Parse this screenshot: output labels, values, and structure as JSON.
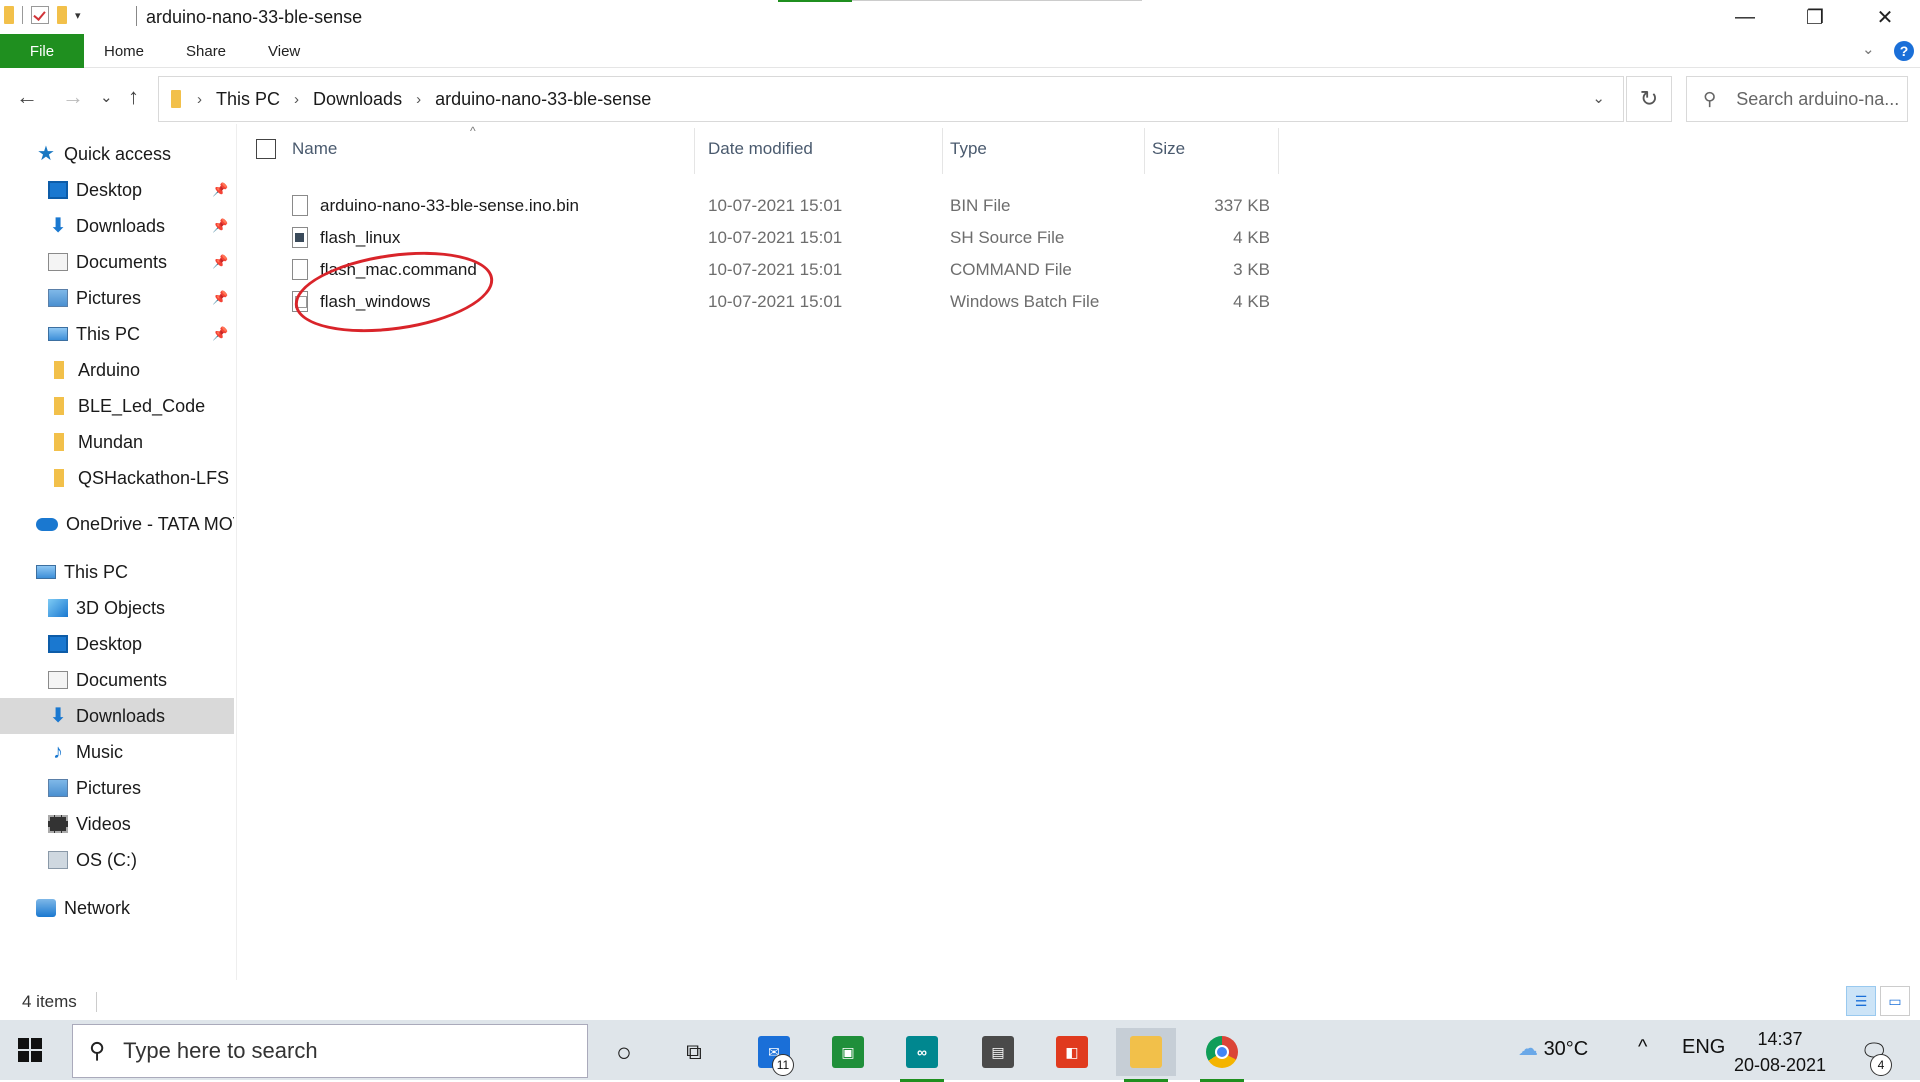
{
  "window": {
    "title": "arduino-nano-33-ble-sense",
    "controls": {
      "minimize": "—",
      "maximize": "❐",
      "close": "✕"
    }
  },
  "ribbon": {
    "tabs": [
      "File",
      "Home",
      "Share",
      "View"
    ],
    "help": "?",
    "expand": "⌄"
  },
  "address": {
    "nav": {
      "back": "←",
      "forward": "→",
      "recent": "⌄",
      "up": "↑"
    },
    "crumbs": [
      "This PC",
      "Downloads",
      "arduino-nano-33-ble-sense"
    ],
    "separator": "›",
    "dropdown": "⌄",
    "refresh": "↻",
    "search_placeholder": "Search arduino-na..."
  },
  "nav_pane": {
    "pin_glyph": "📌",
    "items": [
      {
        "label": "Quick access",
        "icon": "star-icon"
      },
      {
        "label": "Desktop",
        "icon": "desktop-icon",
        "pinned": true
      },
      {
        "label": "Downloads",
        "icon": "download-icon",
        "pinned": true
      },
      {
        "label": "Documents",
        "icon": "documents-icon",
        "pinned": true
      },
      {
        "label": "Pictures",
        "icon": "pictures-icon",
        "pinned": true
      },
      {
        "label": "This PC",
        "icon": "computer-icon",
        "pinned": true
      },
      {
        "label": "Arduino",
        "icon": "folder-icon"
      },
      {
        "label": "BLE_Led_Code",
        "icon": "folder-icon"
      },
      {
        "label": "Mundan",
        "icon": "folder-icon"
      },
      {
        "label": "QSHackathon-LFS s",
        "icon": "folder-icon"
      },
      {
        "label": "OneDrive - TATA MOT",
        "icon": "cloud-icon"
      },
      {
        "label": "This PC",
        "icon": "computer-icon"
      },
      {
        "label": "3D Objects",
        "icon": "cube-icon"
      },
      {
        "label": "Desktop",
        "icon": "desktop-icon"
      },
      {
        "label": "Documents",
        "icon": "documents-icon"
      },
      {
        "label": "Downloads",
        "icon": "download-icon",
        "selected": true
      },
      {
        "label": "Music",
        "icon": "music-icon"
      },
      {
        "label": "Pictures",
        "icon": "pictures-icon"
      },
      {
        "label": "Videos",
        "icon": "videos-icon"
      },
      {
        "label": "OS (C:)",
        "icon": "drive-icon"
      },
      {
        "label": "Network",
        "icon": "network-icon"
      }
    ]
  },
  "file_list": {
    "columns": [
      "Name",
      "Date modified",
      "Type",
      "Size"
    ],
    "sort_indicator": "^",
    "rows": [
      {
        "name": "arduino-nano-33-ble-sense.ino.bin",
        "date": "10-07-2021 15:01",
        "type": "BIN File",
        "size": "337 KB",
        "icon": "file-icon"
      },
      {
        "name": "flash_linux",
        "date": "10-07-2021 15:01",
        "type": "SH Source File",
        "size": "4 KB",
        "icon": "script-file-icon"
      },
      {
        "name": "flash_mac.command",
        "date": "10-07-2021 15:01",
        "type": "COMMAND File",
        "size": "3 KB",
        "icon": "file-icon"
      },
      {
        "name": "flash_windows",
        "date": "10-07-2021 15:01",
        "type": "Windows Batch File",
        "size": "4 KB",
        "icon": "batch-file-icon"
      }
    ],
    "annotation_color": "#d9242a"
  },
  "status": {
    "items_count": "4 items"
  },
  "taskbar": {
    "search_placeholder": "Type here to search",
    "mail_badge": "11",
    "weather": "30°C",
    "language": "ENG",
    "time": "14:37",
    "date": "20-08-2021",
    "notification_badge": "4",
    "accent": "#1f8f1f"
  }
}
